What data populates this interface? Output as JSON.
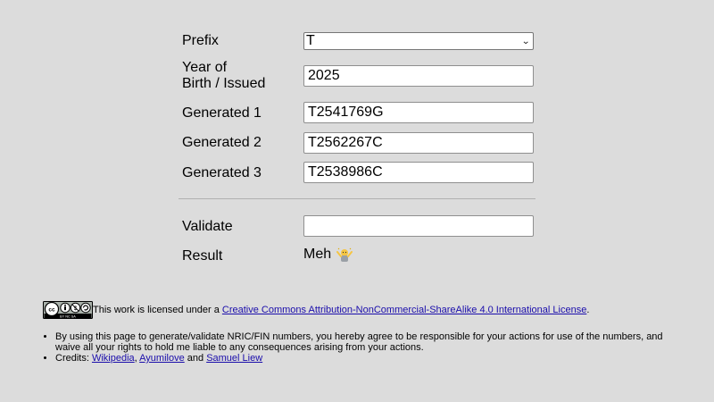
{
  "form": {
    "prefix": {
      "label": "Prefix",
      "value": "T"
    },
    "year": {
      "label_line1": "Year of",
      "label_line2": "Birth / Issued",
      "value": "2025"
    },
    "generated": [
      {
        "label": "Generated 1",
        "value": "T2541769G"
      },
      {
        "label": "Generated 2",
        "value": "T2562267C"
      },
      {
        "label": "Generated 3",
        "value": "T2538986C"
      }
    ],
    "validate": {
      "label": "Validate",
      "value": ""
    },
    "result": {
      "label": "Result",
      "value": "Meh",
      "icon": "shrug-emoji-icon"
    }
  },
  "footer": {
    "license_badge": "cc-by-nc-sa-badge",
    "license_badge_text": "BY NC SA",
    "license_prefix": "This work is licensed under a ",
    "license_link": "Creative Commons Attribution-NonCommercial-ShareAlike 4.0 International License",
    "license_suffix": ".",
    "disclaimer": "By using this page to generate/validate NRIC/FIN numbers, you hereby agree to be responsible for your actions for use of the numbers, and waive all your rights to hold me liable to any consequences arising from your actions.",
    "credits_prefix": "Credits: ",
    "credit_links": [
      "Wikipedia",
      "Ayumilove",
      "Samuel Liew"
    ],
    "credits_sep": ", ",
    "credits_and": " and "
  }
}
